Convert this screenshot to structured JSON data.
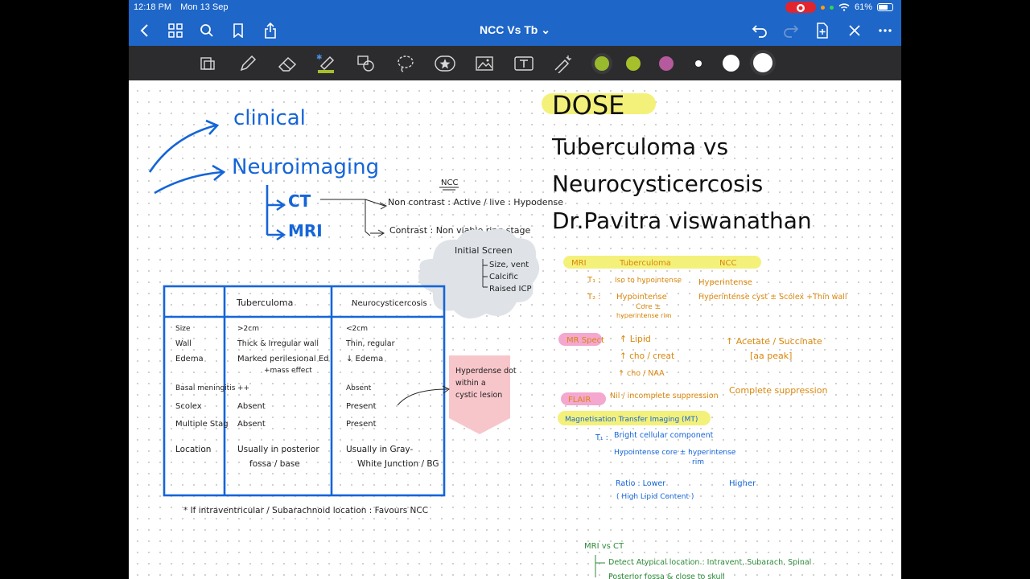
{
  "status": {
    "time": "12:18 PM",
    "date": "Mon 13 Sep",
    "battery": "61%"
  },
  "nav": {
    "title": "NCC Vs Tb ⌄"
  },
  "colors": {
    "bar": "#1e66c7",
    "toolbar": "#2c2c2e",
    "blue_ink": "#1565d8",
    "orange_ink": "#d9860a",
    "highlight_yellow": "#f4f17a",
    "highlight_pink": "#f4a7cf"
  },
  "toolbar_swatches": [
    "#9aba2e",
    "#a6c02b",
    "#b65a9e",
    "#ffffff",
    "#ffffff",
    "#ffffff"
  ],
  "notes": {
    "title": {
      "dose": "DOSE",
      "line1": "Tuberculoma vs",
      "line2": "Neurocysticercosis",
      "line3": "Dr.Pavitra viswanathan"
    },
    "flow": {
      "clinical": "clinical",
      "neuroimaging": "Neuroimaging",
      "ct": "CT",
      "mri": "MRI",
      "ncc": "NCC",
      "non_contrast": "Non contrast : Active / live : Hypodense",
      "contrast": "Contrast : Non viable ring stage"
    },
    "cloud": {
      "head": "Initial Screen",
      "l1": "Size, vent",
      "l2": "Calcific",
      "l3": "Raised ICP"
    },
    "table": {
      "col1": "Tuberculoma",
      "col2": "Neurocysticercosis",
      "rows": [
        {
          "label": "Size",
          "tb": ">2cm",
          "ncc": "<2cm"
        },
        {
          "label": "Wall",
          "tb": "Thick & Irregular wall",
          "ncc": "Thin, regular"
        },
        {
          "label": "Edema",
          "tb": "Marked perilesional Ed",
          "ncc": "↓ Edema"
        },
        {
          "label": "",
          "tb": "+mass effect",
          "ncc": ""
        },
        {
          "label": "Basal meningitis",
          "tb": "++",
          "ncc": "Absent"
        },
        {
          "label": "Scolex",
          "tb": "Absent",
          "ncc": "Present"
        },
        {
          "label": "Multiple Stag",
          "tb": "Absent",
          "ncc": "Present"
        },
        {
          "label": "Location",
          "tb": "Usually in posterior",
          "ncc": "Usually in Gray-"
        },
        {
          "label": "",
          "tb": "fossa / base",
          "ncc": "White Junction / BG"
        }
      ]
    },
    "callout": {
      "l1": "Hyperdense dot",
      "l2": "within a",
      "l3": "cystic lesion"
    },
    "footnote": "* If intraventricular / Subarachnoid location : Favours NCC",
    "mri": {
      "header": [
        "MRI",
        "Tuberculoma",
        "NCC"
      ],
      "t1_label": "T₁ :",
      "t1_tb": "Iso to hypointense",
      "t1_ncc": "Hyperintense",
      "t2_label": "T₂ :",
      "t2_tb1": "Hypointense",
      "t2_tb2": "Core ±",
      "t2_tb3": "hyperintense rim",
      "t2_ncc": "Hyperintense cyst ± Scolex +Thin wall",
      "mrspect": "MR Spect",
      "sp1": "↑ Lipid",
      "sp2": "↑ cho / creat",
      "sp3": "↑ cho / NAA",
      "sp_ncc1": "↑ Acetate / Succinate",
      "sp_ncc2": "[aa peak]",
      "flair": "FLAIR",
      "flair_tb": "Nil / incomplete suppression",
      "flair_ncc": "Complete suppression",
      "mt": "Magnetisation Transfer Imaging (MT)",
      "mt_t1": "T₁ :",
      "mt_l1": "Bright cellular component",
      "mt_l2": "Hypointense core ± hyperintense",
      "mt_l3": "rim",
      "ratio": "Ratio : Lower",
      "ratio_sub": "( High Lipid Content )",
      "ratio_ncc": "Higher",
      "mrivsct": "MRI   vs   CT",
      "g1": "Detect Atypical location : Intravent, Subarach, Spinal",
      "g2": "Posterior fossa & close to skull"
    }
  }
}
